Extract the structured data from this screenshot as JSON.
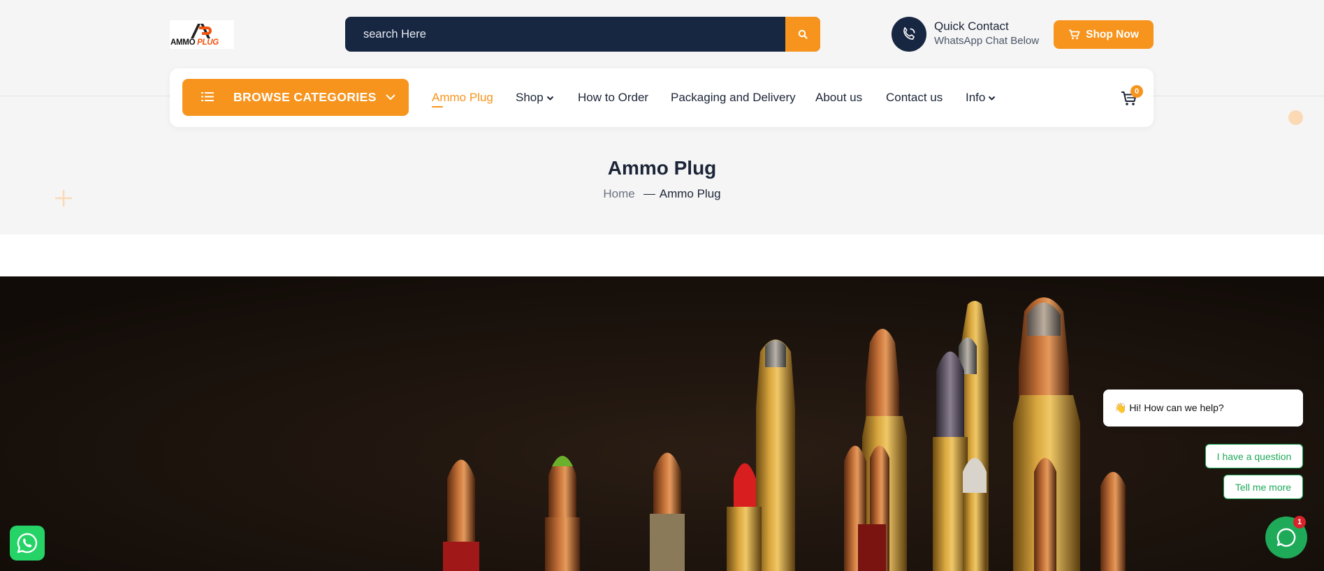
{
  "logo": {
    "prefix": "AMMO",
    "suffix": "PLUG"
  },
  "search": {
    "placeholder": "search Here"
  },
  "quick_contact": {
    "title": "Quick Contact",
    "subtitle": "WhatsApp Chat Below"
  },
  "header": {
    "shop_now_label": "Shop Now"
  },
  "nav": {
    "browse_label": "BROWSE CATEGORIES",
    "items": [
      {
        "label": "Ammo Plug",
        "active": true
      },
      {
        "label": "Shop",
        "has_dropdown": true
      },
      {
        "label": "How to Order"
      },
      {
        "label": "Packaging and Delivery"
      },
      {
        "label": "About us"
      },
      {
        "label": "Contact us"
      },
      {
        "label": "Info",
        "has_dropdown": true
      }
    ],
    "cart_count": "0"
  },
  "page": {
    "title": "Ammo Plug",
    "breadcrumb": {
      "home": "Home",
      "current": "Ammo Plug"
    }
  },
  "chat": {
    "greeting": "👋 Hi! How can we help?",
    "options": [
      "I have a question",
      "Tell me more"
    ],
    "badge": "1"
  },
  "icons": {
    "search": "search-icon",
    "phone": "phone-icon",
    "cart": "cart-icon",
    "list": "list-icon",
    "chevron": "chevron-down-icon",
    "chat": "chat-icon",
    "whatsapp": "whatsapp-icon"
  },
  "colors": {
    "accent": "#f7941d",
    "navy": "#172641",
    "chat_green": "#1faa59",
    "whatsapp": "#25d366"
  }
}
